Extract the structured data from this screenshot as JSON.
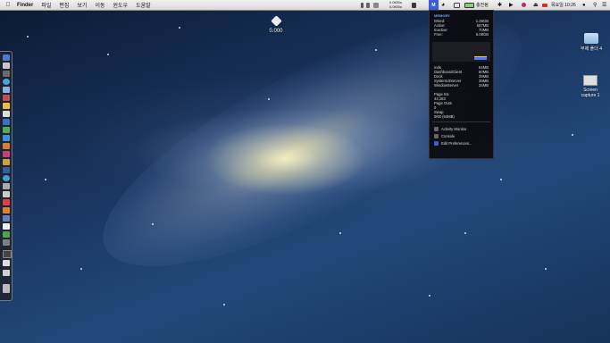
{
  "menubar": {
    "apple_icon": "apple-icon",
    "app_name": "Finder",
    "menus": [
      "파일",
      "편집",
      "보기",
      "이동",
      "윈도우",
      "도움말"
    ],
    "net_up": "0.0KB/s",
    "net_down": "0.0KB/s",
    "battery_text": "충전됨",
    "clock": "목요일 10:26",
    "colors": {
      "accent": "#3b5bdb"
    }
  },
  "desktop": {
    "widget_value": "0.000",
    "folder_label": "무제 폴더 4",
    "screenshot_label_1": "Screen",
    "screenshot_label_2": "capture 1"
  },
  "memory_popup": {
    "title": "MEMORY",
    "stats": [
      {
        "label": "Wired:",
        "value": "1.26GB"
      },
      {
        "label": "Active:",
        "value": "597MB"
      },
      {
        "label": "Inactive:",
        "value": "70MB"
      },
      {
        "label": "Free:",
        "value": "6.08GB"
      }
    ],
    "processes": [
      {
        "name": "mds",
        "value": "64MB"
      },
      {
        "name": "DashboardClient",
        "value": "60MB"
      },
      {
        "name": "Dock",
        "value": "39MB"
      },
      {
        "name": "SystemUIServer",
        "value": "39MB"
      },
      {
        "name": "WindowServer",
        "value": "34MB"
      }
    ],
    "page_ins_label": "Page Ins",
    "page_ins_value": "44,183",
    "page_outs_label": "Page Outs",
    "page_outs_value": "0",
    "swap_label": "Swap",
    "swap_value": "0KB (64MB)",
    "actions": [
      "Activity Monitor",
      "Console",
      "Edit Preferences..."
    ]
  }
}
